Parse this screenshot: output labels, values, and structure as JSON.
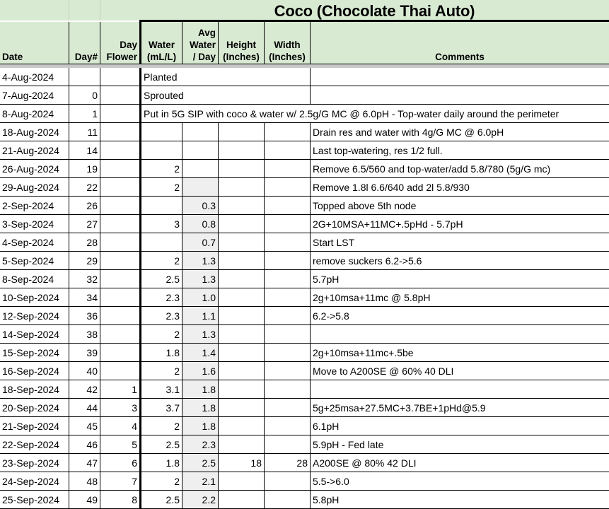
{
  "sheet": {
    "title": "Coco (Chocolate Thai Auto)",
    "headers": {
      "date": "Date",
      "day": "Day#",
      "flower_1": "Day",
      "flower_2": "Flower",
      "water_1": "Water",
      "water_2": "(mL/L)",
      "avg_1": "Avg",
      "avg_2": "Water",
      "avg_3": "/ Day",
      "height_1": "Height",
      "height_2": "(Inches)",
      "width_1": "Width",
      "width_2": "(Inches)",
      "comments": "Comments"
    },
    "colors": {
      "header_bg": "#d9ead3",
      "avg_col_bg": "#efefef",
      "separator": "#c8c8c8"
    },
    "rows": [
      {
        "date": "4-Aug-2024",
        "day": "",
        "flower": "",
        "water": "",
        "avg": "",
        "height": "",
        "width": "",
        "comment": "",
        "span_text": "Planted"
      },
      {
        "date": "7-Aug-2024",
        "day": "0",
        "flower": "",
        "water": "",
        "avg": "",
        "height": "",
        "width": "",
        "comment": "",
        "span_text": "Sprouted"
      },
      {
        "date": "8-Aug-2024",
        "day": "1",
        "flower": "",
        "water": "",
        "avg": "",
        "height": "",
        "width": "",
        "comment": "",
        "span_text": "Put in 5G SIP with coco & water w/ 2.5g/G MC @ 6.0pH - Top-water daily around the perimeter"
      },
      {
        "date": "18-Aug-2024",
        "day": "11",
        "flower": "",
        "water": "",
        "avg": "",
        "height": "",
        "width": "",
        "comment": "Drain res and water with 4g/G MC @ 6.0pH"
      },
      {
        "date": "21-Aug-2024",
        "day": "14",
        "flower": "",
        "water": "",
        "avg": "",
        "height": "",
        "width": "",
        "comment": "Last top-watering, res 1/2 full."
      },
      {
        "date": "26-Aug-2024",
        "day": "19",
        "flower": "",
        "water": "2",
        "avg": "",
        "height": "",
        "width": "",
        "comment": "Remove 6.5/560 and top-water/add 5.8/780 (5g/G mc)"
      },
      {
        "date": "29-Aug-2024",
        "day": "22",
        "flower": "",
        "water": "2",
        "avg": "",
        "height": "",
        "width": "",
        "comment": "Remove 1.8l 6.6/640 add 2l 5.8/930"
      },
      {
        "date": "2-Sep-2024",
        "day": "26",
        "flower": "",
        "water": "",
        "avg": "0.3",
        "height": "",
        "width": "",
        "comment": "Topped above 5th node"
      },
      {
        "date": "3-Sep-2024",
        "day": "27",
        "flower": "",
        "water": "3",
        "avg": "0.8",
        "height": "",
        "width": "",
        "comment": "2G+10MSA+11MC+.5pHd - 5.7pH"
      },
      {
        "date": "4-Sep-2024",
        "day": "28",
        "flower": "",
        "water": "",
        "avg": "0.7",
        "height": "",
        "width": "",
        "comment": "Start LST"
      },
      {
        "date": "5-Sep-2024",
        "day": "29",
        "flower": "",
        "water": "2",
        "avg": "1.3",
        "height": "",
        "width": "",
        "comment": "remove suckers 6.2->5.6"
      },
      {
        "date": "8-Sep-2024",
        "day": "32",
        "flower": "",
        "water": "2.5",
        "avg": "1.3",
        "height": "",
        "width": "",
        "comment": "5.7pH"
      },
      {
        "date": "10-Sep-2024",
        "day": "34",
        "flower": "",
        "water": "2.3",
        "avg": "1.0",
        "height": "",
        "width": "",
        "comment": "2g+10msa+11mc @ 5.8pH"
      },
      {
        "date": "12-Sep-2024",
        "day": "36",
        "flower": "",
        "water": "2.3",
        "avg": "1.1",
        "height": "",
        "width": "",
        "comment": "6.2->5.8"
      },
      {
        "date": "14-Sep-2024",
        "day": "38",
        "flower": "",
        "water": "2",
        "avg": "1.3",
        "height": "",
        "width": "",
        "comment": ""
      },
      {
        "date": "15-Sep-2024",
        "day": "39",
        "flower": "",
        "water": "1.8",
        "avg": "1.4",
        "height": "",
        "width": "",
        "comment": "2g+10msa+11mc+.5be"
      },
      {
        "date": "16-Sep-2024",
        "day": "40",
        "flower": "",
        "water": "2",
        "avg": "1.6",
        "height": "",
        "width": "",
        "comment": "Move to A200SE @ 60% 40 DLI"
      },
      {
        "date": "18-Sep-2024",
        "day": "42",
        "flower": "1",
        "water": "3.1",
        "avg": "1.8",
        "height": "",
        "width": "",
        "comment": ""
      },
      {
        "date": "20-Sep-2024",
        "day": "44",
        "flower": "3",
        "water": "3.7",
        "avg": "1.8",
        "height": "",
        "width": "",
        "comment": "5g+25msa+27.5MC+3.7BE+1pHd@5.9"
      },
      {
        "date": "21-Sep-2024",
        "day": "45",
        "flower": "4",
        "water": "2",
        "avg": "1.8",
        "height": "",
        "width": "",
        "comment": "6.1pH"
      },
      {
        "date": "22-Sep-2024",
        "day": "46",
        "flower": "5",
        "water": "2.5",
        "avg": "2.3",
        "height": "",
        "width": "",
        "comment": "5.9pH - Fed late"
      },
      {
        "date": "23-Sep-2024",
        "day": "47",
        "flower": "6",
        "water": "1.8",
        "avg": "2.5",
        "height": "18",
        "width": "28",
        "comment": "A200SE @ 80% 42 DLI"
      },
      {
        "date": "24-Sep-2024",
        "day": "48",
        "flower": "7",
        "water": "2",
        "avg": "2.1",
        "height": "",
        "width": "",
        "comment": "5.5->6.0"
      },
      {
        "date": "25-Sep-2024",
        "day": "49",
        "flower": "8",
        "water": "2.5",
        "avg": "2.2",
        "height": "",
        "width": "",
        "comment": "5.8pH"
      }
    ]
  }
}
